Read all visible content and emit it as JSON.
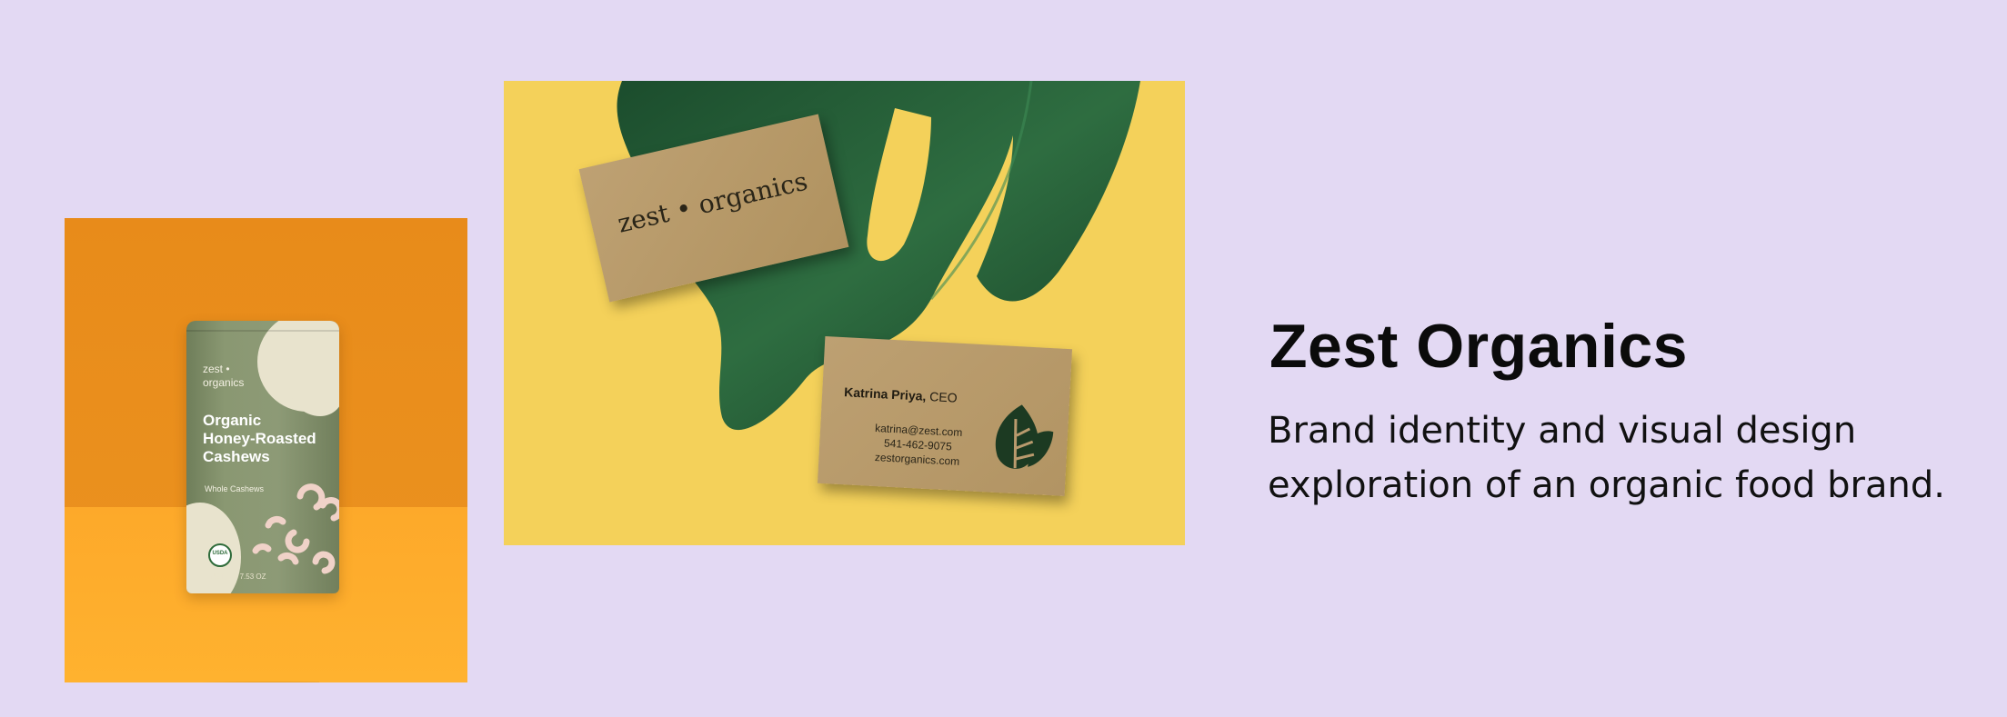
{
  "pouch": {
    "brand": "zest •\norganics",
    "product": "Organic\nHoney-Roasted\nCashews",
    "subtitle": "Whole Cashews",
    "seal": "USDA",
    "weight": "NET WT 7.53 OZ"
  },
  "business_card_front": {
    "logo_text": "zest • organics"
  },
  "business_card_back": {
    "name": "Katrina Priya,",
    "role": "CEO",
    "email": "katrina@zest.com",
    "phone": "541-462-9075",
    "website": "zestorganics.com"
  },
  "project": {
    "title": "Zest Organics",
    "description_line1": "Brand identity and visual design",
    "description_line2": "exploration of an organic food brand."
  },
  "colors": {
    "background": "#e3d9f3",
    "orange_backdrop": "#e88b1a",
    "yellow_backdrop": "#f4d15a",
    "pouch_green": "#8d9a76",
    "kraft": "#b99a6d",
    "leaf_green": "#1f4d2f"
  }
}
